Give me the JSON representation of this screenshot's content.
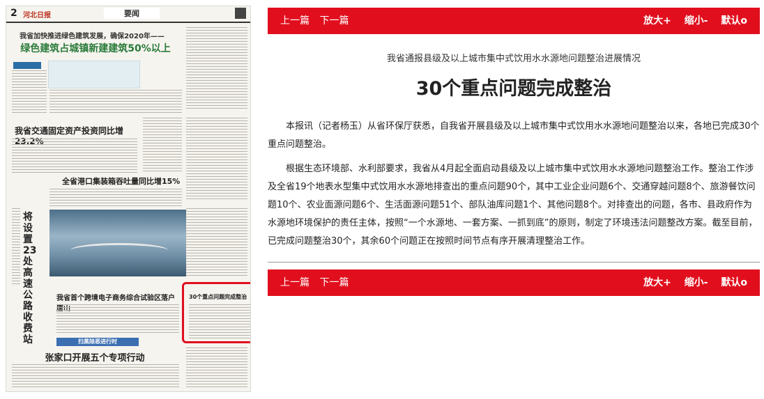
{
  "paper_thumbnail": {
    "page_number": "2",
    "paper_name": "河北日报",
    "section": "要闻",
    "headline_top": "我省加快推进绿色建筑发展，确保2020年——",
    "headline_green": "绿色建筑占城镇新建建筑50%以上",
    "headline_traffic": "我省交通固定资产投资同比增23.2%",
    "headline_port": "全省港口集装箱吞吐量同比增15%",
    "headline_ecommerce": "我省首个跨境电子商务综合试验区落户唐山",
    "headline_vertical": "将设置23处高速公路收费站",
    "headline_bottom": "张家口开展五个专项行动",
    "headline_highlight": "30个重点问题完成整治",
    "band_text": "扫黑除恶进行时"
  },
  "toolbar": {
    "prev": "上一篇",
    "next": "下一篇",
    "zoom_in": "放大+",
    "zoom_out": "缩小-",
    "default": "默认o"
  },
  "article": {
    "pre_title": "我省通报县级及以上城市集中式饮用水水源地问题整治进展情况",
    "title": "30个重点问题完成整治",
    "paragraph_1": "本报讯（记者杨玉）从省环保厅获悉，自我省开展县级及以上城市集中式饮用水水源地问题整治以来，各地已完成30个重点问题整治。",
    "paragraph_2": "根据生态环境部、水利部要求，我省从4月起全面启动县级及以上城市集中式饮用水水源地问题整治工作。整治工作涉及全省19个地表水型集中式饮用水水源地排查出的重点问题90个，其中工业企业问题6个、交通穿越问题8个、旅游餐饮问题10个、农业面源问题6个、生活面源问题51个、部队油库问题1个、其他问题8个。对排查出的问题，各市、县政府作为水源地环境保护的责任主体，按照“一个水源地、一套方案、一抓到底”的原则，制定了环境违法问题整改方案。截至目前，已完成问题整治30个，其余60个问题正在按照时间节点有序开展清理整治工作。"
  }
}
